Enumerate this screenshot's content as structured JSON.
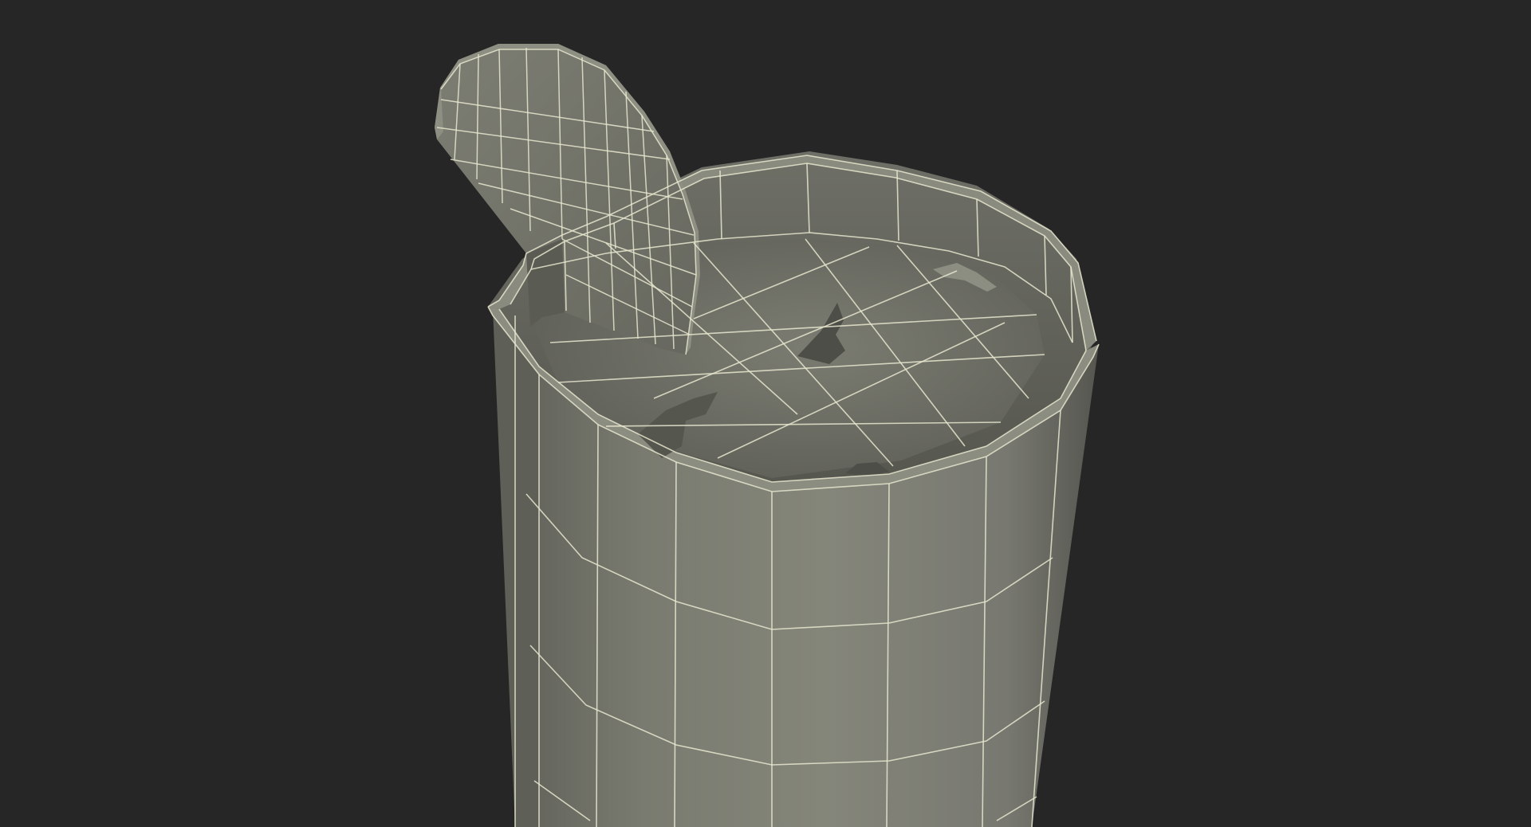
{
  "scene": {
    "background_color": "#262626",
    "object": "wireframe-cylinder-with-lid",
    "surface_color": "#7d7e72",
    "surface_shadow_color": "#5b5c53",
    "interior_color": "#6f7067",
    "interior_floor_color": "#737469",
    "lid_color": "#7a7b6f",
    "wire_color": "#e8e6cf",
    "wire_opacity": 0.85
  }
}
